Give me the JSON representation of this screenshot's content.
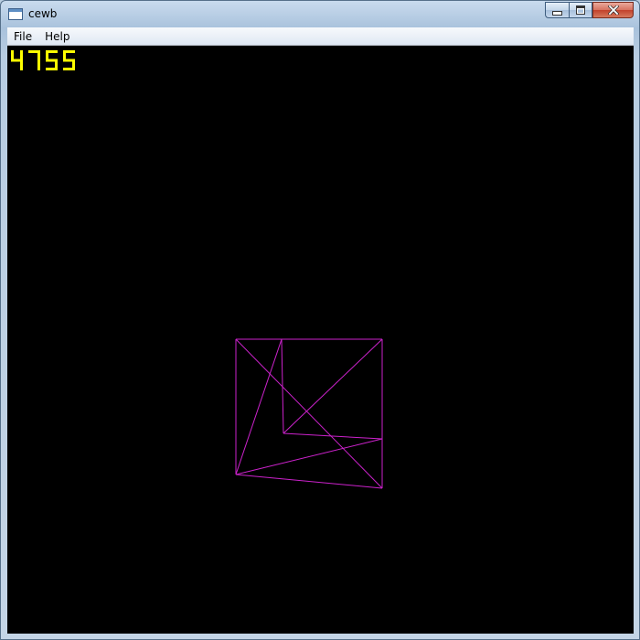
{
  "window": {
    "title": "cewb",
    "controls": {
      "minimize": "minimize",
      "maximize": "maximize",
      "close": "close"
    }
  },
  "menu": {
    "items": [
      "File",
      "Help"
    ]
  },
  "game": {
    "score": "4755",
    "score_color": "#ffff00",
    "wireframe_color": "#cc22cc",
    "background": "#000000"
  }
}
